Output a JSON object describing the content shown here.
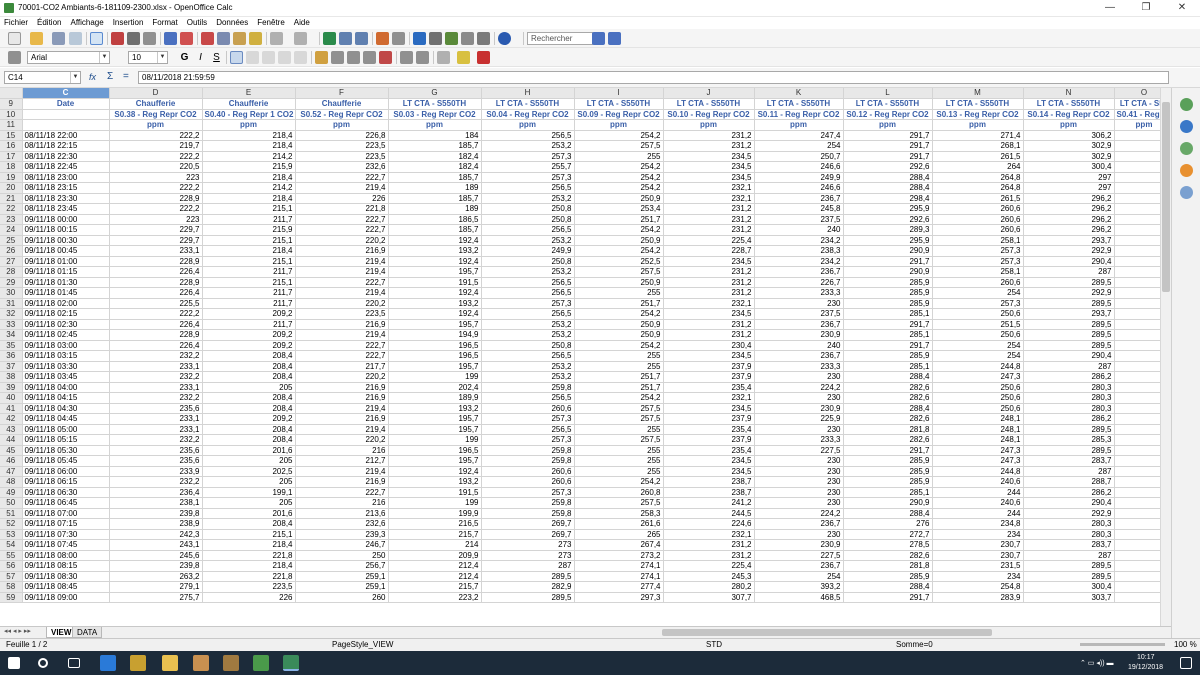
{
  "window": {
    "title": "70001-CO2 Ambiants-6-181109-2300.xlsx - OpenOffice Calc",
    "min": "—",
    "max": "❐",
    "close": "✕"
  },
  "menu": [
    "Fichier",
    "Édition",
    "Affichage",
    "Insertion",
    "Format",
    "Outils",
    "Données",
    "Fenêtre",
    "Aide"
  ],
  "toolbar": {
    "search_placeholder": "Rechercher",
    "font_name": "Arial",
    "font_size": "10",
    "bold": "G",
    "italic": "I",
    "underline": "S"
  },
  "formula": {
    "cell_ref": "C14",
    "value": "08/11/2018 21:59:59",
    "func_icon": "fx",
    "sum_icon": "Σ",
    "eq_icon": "="
  },
  "columns": [
    "C",
    "D",
    "E",
    "F",
    "G",
    "H",
    "I",
    "J",
    "K",
    "L",
    "M",
    "N",
    "O"
  ],
  "header_rows": [
    {
      "row": "9",
      "cells": [
        "Date",
        "Chaufferie",
        "Chaufferie",
        "Chaufferie",
        "LT CTA - S550TH",
        "LT CTA - S550TH",
        "LT CTA - S550TH",
        "LT CTA - S550TH",
        "LT CTA - S550TH",
        "LT CTA - S550TH",
        "LT CTA - S550TH",
        "LT CTA - S550TH",
        "LT CTA - S55"
      ]
    },
    {
      "row": "10",
      "cells": [
        "",
        "S0.38 - Reg Repr CO2",
        "S0.40 - Reg Repr 1 CO2",
        "S0.52 - Reg Repr CO2",
        "S0.03 - Reg Repr CO2",
        "S0.04 - Reg Repr CO2",
        "S0.09 - Reg Repr CO2",
        "S0.10 - Reg Repr CO2",
        "S0.11 - Reg Repr CO2",
        "S0.12 - Reg Repr CO2",
        "S0.13 - Reg Repr CO2",
        "S0.14 - Reg Repr CO2",
        "S0.41 - Reg Re"
      ]
    },
    {
      "row": "11",
      "cells": [
        "",
        "ppm",
        "ppm",
        "ppm",
        "ppm",
        "ppm",
        "ppm",
        "ppm",
        "ppm",
        "ppm",
        "ppm",
        "ppm",
        "ppm"
      ]
    }
  ],
  "rows": [
    [
      "15",
      "08/11/18 22:00",
      "222,2",
      "218,4",
      "226,8",
      "184",
      "256,5",
      "254,2",
      "231,2",
      "247,4",
      "291,7",
      "271,4",
      "306,2",
      ""
    ],
    [
      "16",
      "08/11/18 22:15",
      "219,7",
      "218,4",
      "223,5",
      "185,7",
      "253,2",
      "257,5",
      "231,2",
      "254",
      "291,7",
      "268,1",
      "302,9",
      ""
    ],
    [
      "17",
      "08/11/18 22:30",
      "222,2",
      "214,2",
      "223,5",
      "182,4",
      "257,3",
      "255",
      "234,5",
      "250,7",
      "291,7",
      "261,5",
      "302,9",
      ""
    ],
    [
      "18",
      "08/11/18 22:45",
      "220,5",
      "215,9",
      "232,6",
      "182,4",
      "255,7",
      "254,2",
      "234,5",
      "246,6",
      "292,6",
      "264",
      "300,4",
      ""
    ],
    [
      "19",
      "08/11/18 23:00",
      "223",
      "218,4",
      "222,7",
      "185,7",
      "257,3",
      "254,2",
      "234,5",
      "249,9",
      "288,4",
      "264,8",
      "297",
      ""
    ],
    [
      "20",
      "08/11/18 23:15",
      "222,2",
      "214,2",
      "219,4",
      "189",
      "256,5",
      "254,2",
      "232,1",
      "246,6",
      "288,4",
      "264,8",
      "297",
      ""
    ],
    [
      "21",
      "08/11/18 23:30",
      "228,9",
      "218,4",
      "226",
      "185,7",
      "253,2",
      "250,9",
      "232,1",
      "236,7",
      "298,4",
      "261,5",
      "296,2",
      ""
    ],
    [
      "22",
      "08/11/18 23:45",
      "222,2",
      "215,1",
      "221,8",
      "189",
      "250,8",
      "253,4",
      "231,2",
      "245,8",
      "295,9",
      "260,6",
      "296,2",
      ""
    ],
    [
      "23",
      "09/11/18 00:00",
      "223",
      "211,7",
      "222,7",
      "186,5",
      "250,8",
      "251,7",
      "231,2",
      "237,5",
      "292,6",
      "260,6",
      "296,2",
      ""
    ],
    [
      "24",
      "09/11/18 00:15",
      "229,7",
      "215,9",
      "222,7",
      "185,7",
      "256,5",
      "254,2",
      "231,2",
      "240",
      "289,3",
      "260,6",
      "296,2",
      ""
    ],
    [
      "25",
      "09/11/18 00:30",
      "229,7",
      "215,1",
      "220,2",
      "192,4",
      "253,2",
      "250,9",
      "225,4",
      "234,2",
      "295,9",
      "258,1",
      "293,7",
      ""
    ],
    [
      "26",
      "09/11/18 00:45",
      "233,1",
      "218,4",
      "216,9",
      "193,2",
      "249,9",
      "254,2",
      "228,7",
      "238,3",
      "290,9",
      "257,3",
      "292,9",
      ""
    ],
    [
      "27",
      "09/11/18 01:00",
      "228,9",
      "215,1",
      "219,4",
      "192,4",
      "250,8",
      "252,5",
      "234,5",
      "234,2",
      "291,7",
      "257,3",
      "290,4",
      ""
    ],
    [
      "28",
      "09/11/18 01:15",
      "226,4",
      "211,7",
      "219,4",
      "195,7",
      "253,2",
      "257,5",
      "231,2",
      "236,7",
      "290,9",
      "258,1",
      "287",
      ""
    ],
    [
      "29",
      "09/11/18 01:30",
      "228,9",
      "215,1",
      "222,7",
      "191,5",
      "256,5",
      "250,9",
      "231,2",
      "226,7",
      "285,9",
      "260,6",
      "289,5",
      ""
    ],
    [
      "30",
      "09/11/18 01:45",
      "226,4",
      "211,7",
      "219,4",
      "192,4",
      "256,5",
      "255",
      "231,2",
      "233,3",
      "285,9",
      "254",
      "292,9",
      ""
    ],
    [
      "31",
      "09/11/18 02:00",
      "225,5",
      "211,7",
      "220,2",
      "193,2",
      "257,3",
      "251,7",
      "232,1",
      "230",
      "285,9",
      "257,3",
      "289,5",
      ""
    ],
    [
      "32",
      "09/11/18 02:15",
      "222,2",
      "209,2",
      "223,5",
      "192,4",
      "256,5",
      "254,2",
      "234,5",
      "237,5",
      "285,1",
      "250,6",
      "293,7",
      ""
    ],
    [
      "33",
      "09/11/18 02:30",
      "226,4",
      "211,7",
      "216,9",
      "195,7",
      "253,2",
      "250,9",
      "231,2",
      "236,7",
      "291,7",
      "251,5",
      "289,5",
      ""
    ],
    [
      "34",
      "09/11/18 02:45",
      "228,9",
      "209,2",
      "219,4",
      "194,9",
      "253,2",
      "250,9",
      "231,2",
      "230,9",
      "285,1",
      "250,6",
      "289,5",
      ""
    ],
    [
      "35",
      "09/11/18 03:00",
      "226,4",
      "209,2",
      "222,7",
      "196,5",
      "250,8",
      "254,2",
      "230,4",
      "240",
      "291,7",
      "254",
      "289,5",
      ""
    ],
    [
      "36",
      "09/11/18 03:15",
      "232,2",
      "208,4",
      "222,7",
      "196,5",
      "256,5",
      "255",
      "234,5",
      "236,7",
      "285,9",
      "254",
      "290,4",
      ""
    ],
    [
      "37",
      "09/11/18 03:30",
      "233,1",
      "208,4",
      "217,7",
      "195,7",
      "253,2",
      "255",
      "237,9",
      "233,3",
      "285,1",
      "244,8",
      "287",
      ""
    ],
    [
      "38",
      "09/11/18 03:45",
      "232,2",
      "208,4",
      "220,2",
      "199",
      "253,2",
      "251,7",
      "237,9",
      "230",
      "288,4",
      "247,3",
      "286,2",
      ""
    ],
    [
      "39",
      "09/11/18 04:00",
      "233,1",
      "205",
      "216,9",
      "202,4",
      "259,8",
      "251,7",
      "235,4",
      "224,2",
      "282,6",
      "250,6",
      "280,3",
      ""
    ],
    [
      "40",
      "09/11/18 04:15",
      "232,2",
      "208,4",
      "216,9",
      "189,9",
      "256,5",
      "254,2",
      "232,1",
      "230",
      "282,6",
      "250,6",
      "280,3",
      ""
    ],
    [
      "41",
      "09/11/18 04:30",
      "235,6",
      "208,4",
      "219,4",
      "193,2",
      "260,6",
      "257,5",
      "234,5",
      "230,9",
      "288,4",
      "250,6",
      "280,3",
      ""
    ],
    [
      "42",
      "09/11/18 04:45",
      "233,1",
      "209,2",
      "216,9",
      "195,7",
      "257,3",
      "257,5",
      "237,9",
      "225,9",
      "282,6",
      "248,1",
      "286,2",
      ""
    ],
    [
      "43",
      "09/11/18 05:00",
      "233,1",
      "208,4",
      "219,4",
      "195,7",
      "256,5",
      "255",
      "235,4",
      "230",
      "281,8",
      "248,1",
      "289,5",
      ""
    ],
    [
      "44",
      "09/11/18 05:15",
      "232,2",
      "208,4",
      "220,2",
      "199",
      "257,3",
      "257,5",
      "237,9",
      "233,3",
      "282,6",
      "248,1",
      "285,3",
      ""
    ],
    [
      "45",
      "09/11/18 05:30",
      "235,6",
      "201,6",
      "216",
      "196,5",
      "259,8",
      "255",
      "235,4",
      "227,5",
      "291,7",
      "247,3",
      "289,5",
      ""
    ],
    [
      "46",
      "09/11/18 05:45",
      "235,6",
      "205",
      "212,7",
      "195,7",
      "259,8",
      "255",
      "234,5",
      "230",
      "285,9",
      "247,3",
      "283,7",
      ""
    ],
    [
      "47",
      "09/11/18 06:00",
      "233,9",
      "202,5",
      "219,4",
      "192,4",
      "260,6",
      "255",
      "234,5",
      "230",
      "285,9",
      "244,8",
      "287",
      ""
    ],
    [
      "48",
      "09/11/18 06:15",
      "232,2",
      "205",
      "216,9",
      "193,2",
      "260,6",
      "254,2",
      "238,7",
      "230",
      "285,9",
      "240,6",
      "288,7",
      ""
    ],
    [
      "49",
      "09/11/18 06:30",
      "236,4",
      "199,1",
      "222,7",
      "191,5",
      "257,3",
      "260,8",
      "238,7",
      "230",
      "285,1",
      "244",
      "286,2",
      ""
    ],
    [
      "50",
      "09/11/18 06:45",
      "238,1",
      "205",
      "216",
      "199",
      "259,8",
      "257,5",
      "241,2",
      "230",
      "290,9",
      "240,6",
      "290,4",
      ""
    ],
    [
      "51",
      "09/11/18 07:00",
      "239,8",
      "201,6",
      "213,6",
      "199,9",
      "259,8",
      "258,3",
      "244,5",
      "224,2",
      "288,4",
      "244",
      "292,9",
      ""
    ],
    [
      "52",
      "09/11/18 07:15",
      "238,9",
      "208,4",
      "232,6",
      "216,5",
      "269,7",
      "261,6",
      "224,6",
      "236,7",
      "276",
      "234,8",
      "280,3",
      ""
    ],
    [
      "53",
      "09/11/18 07:30",
      "242,3",
      "215,1",
      "239,3",
      "215,7",
      "269,7",
      "265",
      "232,1",
      "230",
      "272,7",
      "234",
      "280,3",
      ""
    ],
    [
      "54",
      "09/11/18 07:45",
      "243,1",
      "218,4",
      "246,7",
      "214",
      "273",
      "267,4",
      "231,2",
      "230,9",
      "278,5",
      "230,7",
      "283,7",
      ""
    ],
    [
      "55",
      "09/11/18 08:00",
      "245,6",
      "221,8",
      "250",
      "209,9",
      "273",
      "273,2",
      "231,2",
      "227,5",
      "282,6",
      "230,7",
      "287",
      ""
    ],
    [
      "56",
      "09/11/18 08:15",
      "239,8",
      "218,4",
      "256,7",
      "212,4",
      "287",
      "274,1",
      "225,4",
      "236,7",
      "281,8",
      "231,5",
      "289,5",
      ""
    ],
    [
      "57",
      "09/11/18 08:30",
      "263,2",
      "221,8",
      "259,1",
      "212,4",
      "289,5",
      "274,1",
      "245,3",
      "254",
      "285,9",
      "234",
      "289,5",
      ""
    ],
    [
      "58",
      "09/11/18 08:45",
      "279,1",
      "223,5",
      "259,1",
      "215,7",
      "282,9",
      "277,4",
      "280,2",
      "393,2",
      "288,4",
      "254,8",
      "300,4",
      ""
    ],
    [
      "59",
      "09/11/18 09:00",
      "275,7",
      "226",
      "260",
      "223,2",
      "289,5",
      "297,3",
      "307,7",
      "468,5",
      "291,7",
      "283,9",
      "303,7",
      ""
    ]
  ],
  "sheets": [
    "VIEW",
    "DATA"
  ],
  "status": {
    "sheet": "Feuille 1 / 2",
    "style": "PageStyle_VIEW",
    "mode": "STD",
    "sum": "Somme=0",
    "zoom": "100 %"
  },
  "taskbar": {
    "time": "10:17",
    "date": "19/12/2018"
  }
}
